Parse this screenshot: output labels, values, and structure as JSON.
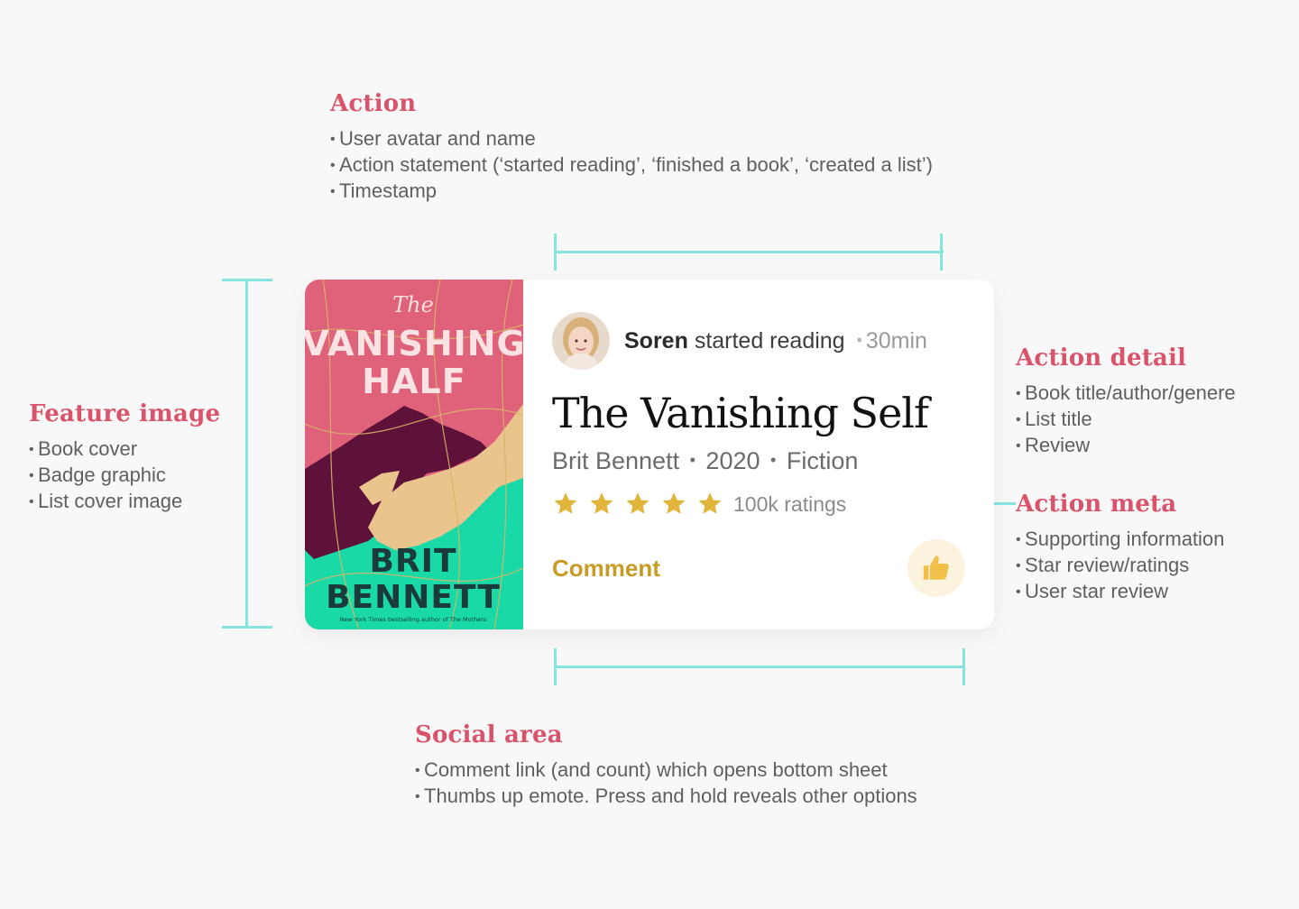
{
  "annotations": {
    "action": {
      "title": "Action",
      "items": [
        "User avatar and name",
        "Action statement (‘started reading’, ‘finished a book’, ‘created a list’)",
        "Timestamp"
      ]
    },
    "feature_image": {
      "title": "Feature image",
      "items": [
        "Book cover",
        "Badge graphic",
        "List cover image"
      ]
    },
    "action_detail": {
      "title": "Action detail",
      "items": [
        "Book title/author/genere",
        "List title",
        "Review"
      ]
    },
    "action_meta": {
      "title": "Action meta",
      "items": [
        "Supporting information",
        "Star review/ratings",
        "User star review"
      ]
    },
    "social_area": {
      "title": "Social area",
      "items": [
        "Comment link (and count) which opens bottom sheet",
        "Thumbs up emote. Press and hold reveals other options"
      ]
    }
  },
  "card": {
    "cover": {
      "title_small": "The",
      "title_line1": "VANISHING",
      "title_line2": "HALF",
      "author_line1": "BRIT",
      "author_line2": "BENNETT",
      "tagline": "New York Times bestselling author of The Mothers"
    },
    "user_name": "Soren",
    "action_text": "started reading",
    "timestamp": "30min",
    "book_title": "The Vanishing Self",
    "author": "Brit Bennett",
    "year": "2020",
    "genre": "Fiction",
    "meta_separator": "•",
    "rating_stars": 5,
    "ratings_count": "100k ratings",
    "comment_label": "Comment",
    "like_icon": "thumbs-up-icon",
    "avatar_icon": "user-avatar"
  },
  "colors": {
    "accent_title": "#d9536a",
    "bracket": "#86e3de",
    "star": "#e1b43c",
    "comment": "#c79b25",
    "like_bg": "#fcf3de"
  }
}
